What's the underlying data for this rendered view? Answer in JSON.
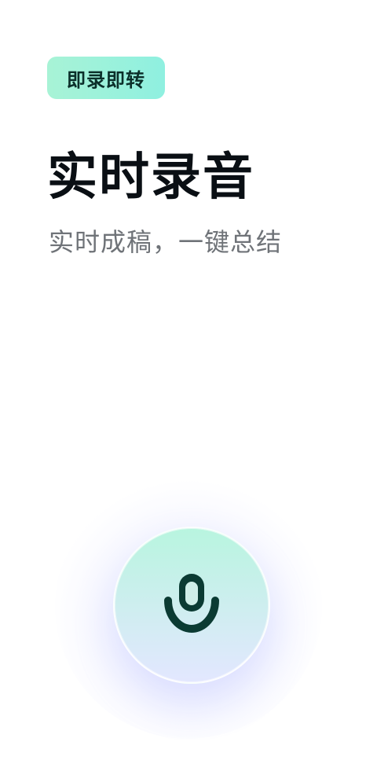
{
  "badge": {
    "label": "即录即转"
  },
  "hero": {
    "title": "实时录音",
    "subtitle": "实时成稿，一键总结"
  },
  "record": {
    "icon": "microphone-icon"
  },
  "colors": {
    "badge_start": "#a8f3d6",
    "badge_end": "#8ff0e0",
    "title": "#0a0f14",
    "subtitle": "#6f7378",
    "mic_top": "#b8f5df",
    "mic_bottom": "#e3e7ff",
    "mic_icon": "#0b3b33"
  }
}
